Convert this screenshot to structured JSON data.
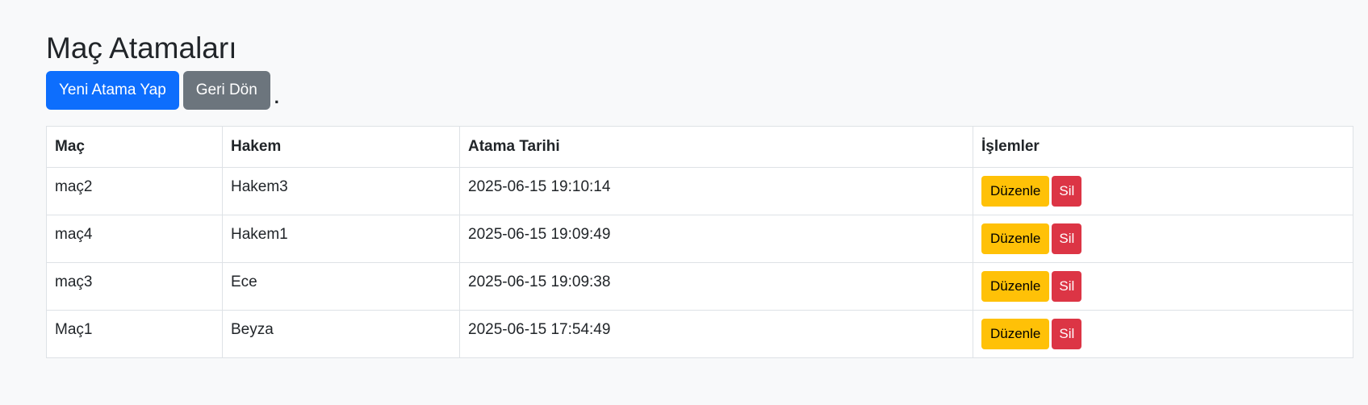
{
  "page": {
    "title": "Maç Atamaları"
  },
  "actions": {
    "new_label": "Yeni Atama Yap",
    "back_label": "Geri Dön",
    "stray_dot": "."
  },
  "table": {
    "headers": [
      "Maç",
      "Hakem",
      "Atama Tarihi",
      "İşlemler"
    ],
    "rows": [
      {
        "match": "maç2",
        "referee": "Hakem3",
        "date": "2025-06-15 19:10:14",
        "edit": "Düzenle",
        "delete": "Sil"
      },
      {
        "match": "maç4",
        "referee": "Hakem1",
        "date": "2025-06-15 19:09:49",
        "edit": "Düzenle",
        "delete": "Sil"
      },
      {
        "match": "maç3",
        "referee": "Ece",
        "date": "2025-06-15 19:09:38",
        "edit": "Düzenle",
        "delete": "Sil"
      },
      {
        "match": "Maç1",
        "referee": "Beyza",
        "date": "2025-06-15 17:54:49",
        "edit": "Düzenle",
        "delete": "Sil"
      }
    ]
  },
  "colors": {
    "primary": "#0d6efd",
    "secondary": "#6c757d",
    "warning": "#ffc107",
    "danger": "#dc3545",
    "background": "#f8f9fa"
  }
}
